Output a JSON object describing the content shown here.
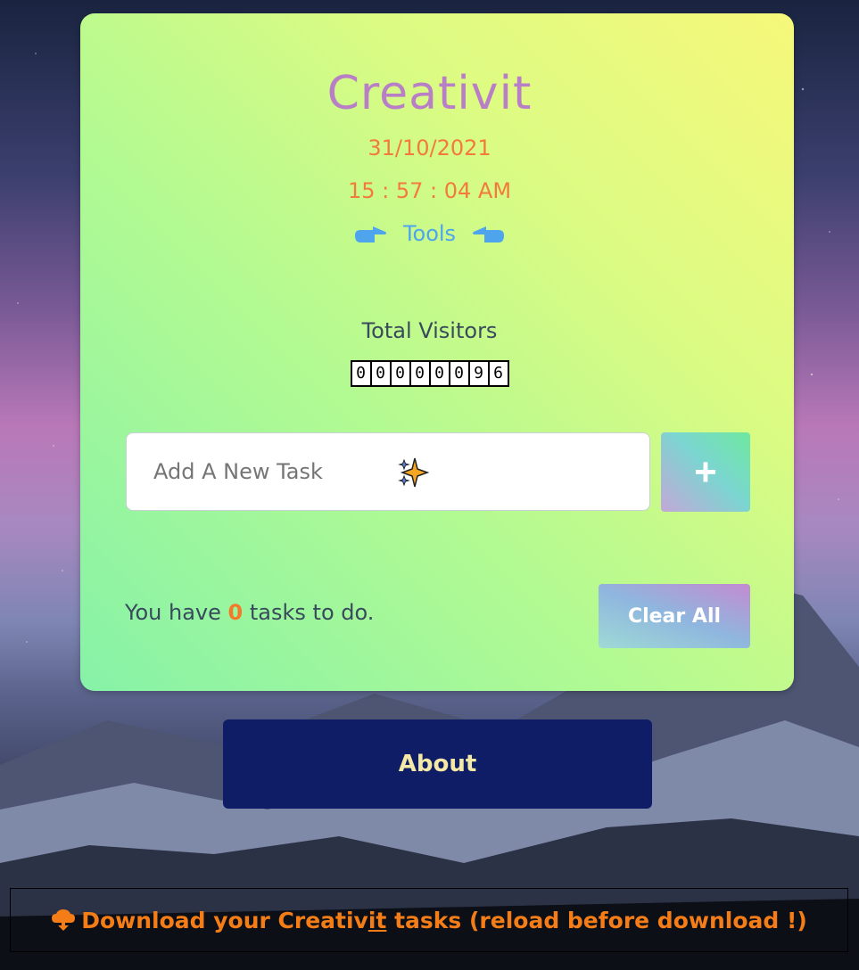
{
  "app": {
    "title": "Creativit",
    "date": "31/10/2021",
    "time": "15 : 57 : 04 AM",
    "tools_label": "Tools"
  },
  "visitors": {
    "label": "Total Visitors",
    "digits": [
      "0",
      "0",
      "0",
      "0",
      "0",
      "0",
      "9",
      "6"
    ]
  },
  "task_input": {
    "placeholder": "Add A New Task"
  },
  "add_button": {
    "label": "+"
  },
  "tasks": {
    "prefix": "You have",
    "count": "0",
    "suffix": "tasks to do."
  },
  "clear_button": {
    "label": "Clear All"
  },
  "about_button": {
    "label": "About"
  },
  "download": {
    "prefix": "Download your Creativ",
    "underlined": "it",
    "suffix": " tasks (reload before download !)"
  },
  "colors": {
    "title": "#b87fc6",
    "date_time": "#f47a3b",
    "tools": "#4fa4ee",
    "about_bg": "#0f1c66",
    "download_text": "#f57d17"
  },
  "icons": {
    "tools_left": "pointing-right-hand-icon",
    "tools_right": "pointing-left-hand-icon",
    "input_sparkle": "sparkle-icon",
    "download": "cloud-download-icon"
  }
}
